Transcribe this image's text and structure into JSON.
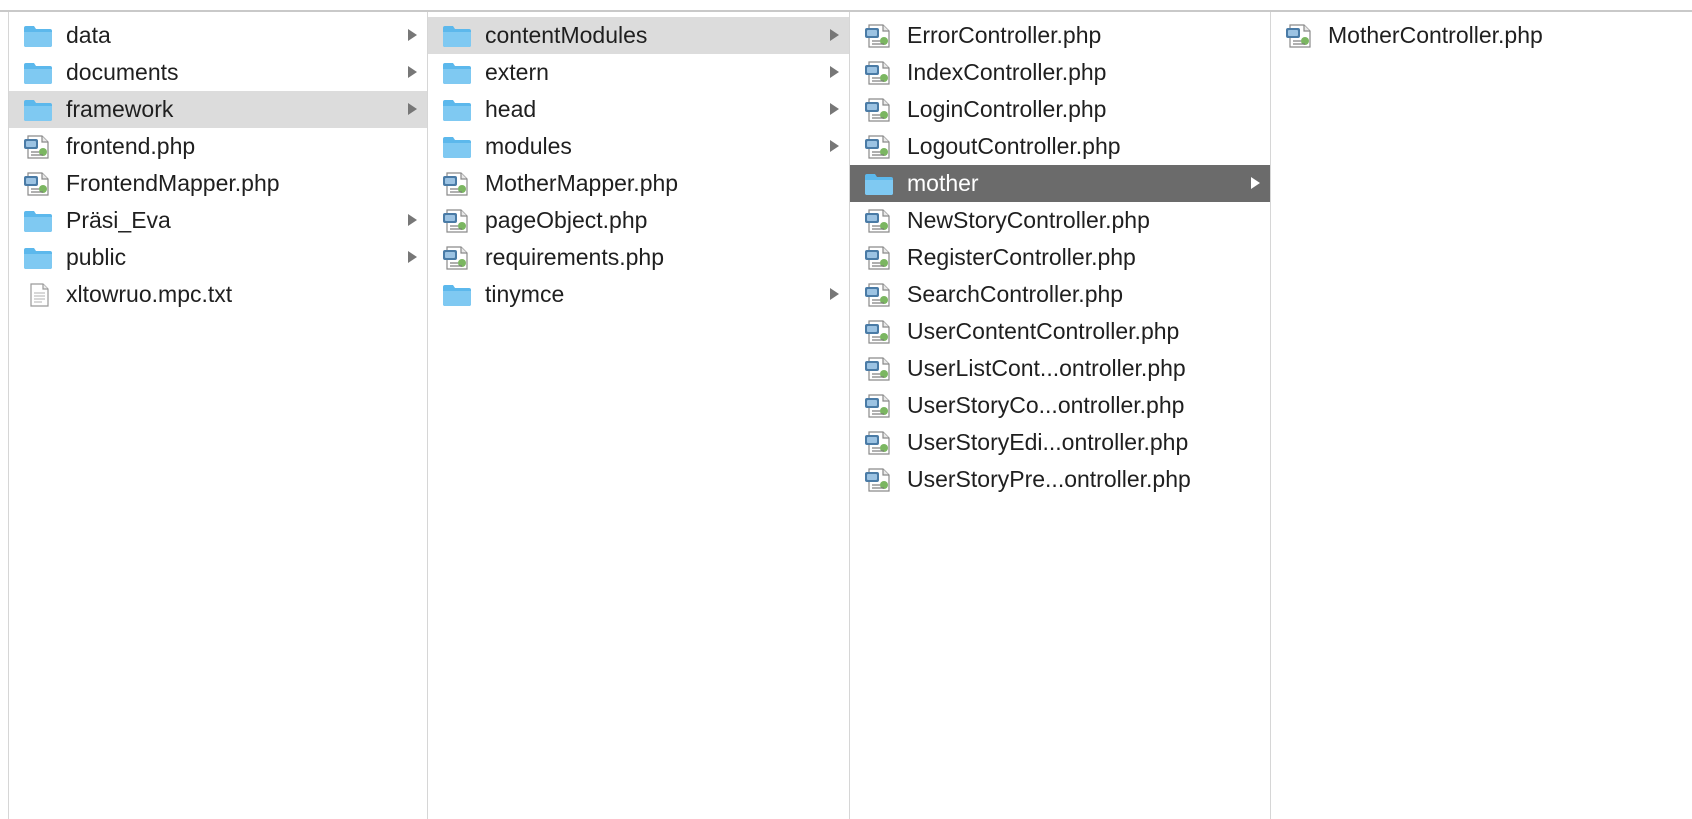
{
  "columns": [
    {
      "items": [
        {
          "label": "data",
          "type": "folder",
          "has_arrow": true
        },
        {
          "label": "documents",
          "type": "folder",
          "has_arrow": true
        },
        {
          "label": "framework",
          "type": "folder",
          "has_arrow": true,
          "selected": "inactive"
        },
        {
          "label": "frontend.php",
          "type": "php",
          "has_arrow": false
        },
        {
          "label": "FrontendMapper.php",
          "type": "php",
          "has_arrow": false
        },
        {
          "label": "Präsi_Eva",
          "type": "folder",
          "has_arrow": true
        },
        {
          "label": "public",
          "type": "folder",
          "has_arrow": true
        },
        {
          "label": "xltowruo.mpc.txt",
          "type": "txt",
          "has_arrow": false
        }
      ]
    },
    {
      "items": [
        {
          "label": "contentModules",
          "type": "folder",
          "has_arrow": true,
          "selected": "inactive"
        },
        {
          "label": "extern",
          "type": "folder",
          "has_arrow": true
        },
        {
          "label": "head",
          "type": "folder",
          "has_arrow": true
        },
        {
          "label": "modules",
          "type": "folder",
          "has_arrow": true
        },
        {
          "label": "MotherMapper.php",
          "type": "php",
          "has_arrow": false
        },
        {
          "label": "pageObject.php",
          "type": "php",
          "has_arrow": false
        },
        {
          "label": "requirements.php",
          "type": "php",
          "has_arrow": false
        },
        {
          "label": "tinymce",
          "type": "folder",
          "has_arrow": true
        }
      ]
    },
    {
      "items": [
        {
          "label": "ErrorController.php",
          "type": "php",
          "has_arrow": false
        },
        {
          "label": "IndexController.php",
          "type": "php",
          "has_arrow": false
        },
        {
          "label": "LoginController.php",
          "type": "php",
          "has_arrow": false
        },
        {
          "label": "LogoutController.php",
          "type": "php",
          "has_arrow": false
        },
        {
          "label": "mother",
          "type": "folder",
          "has_arrow": true,
          "selected": "active"
        },
        {
          "label": "NewStoryController.php",
          "type": "php",
          "has_arrow": false
        },
        {
          "label": "RegisterController.php",
          "type": "php",
          "has_arrow": false
        },
        {
          "label": "SearchController.php",
          "type": "php",
          "has_arrow": false
        },
        {
          "label": "UserContentController.php",
          "type": "php",
          "has_arrow": false
        },
        {
          "label": "UserListCont...ontroller.php",
          "type": "php",
          "has_arrow": false
        },
        {
          "label": "UserStoryCo...ontroller.php",
          "type": "php",
          "has_arrow": false
        },
        {
          "label": "UserStoryEdi...ontroller.php",
          "type": "php",
          "has_arrow": false
        },
        {
          "label": "UserStoryPre...ontroller.php",
          "type": "php",
          "has_arrow": false
        }
      ]
    },
    {
      "items": [
        {
          "label": "MotherController.php",
          "type": "php",
          "has_arrow": false
        }
      ]
    }
  ],
  "colors": {
    "folder": "#5cb8ec",
    "selection_active": "#6b6b6b",
    "selection_inactive": "#dcdcdc"
  },
  "icons": {
    "folder": "folder-icon",
    "php": "php-file-icon",
    "txt": "text-file-icon"
  }
}
